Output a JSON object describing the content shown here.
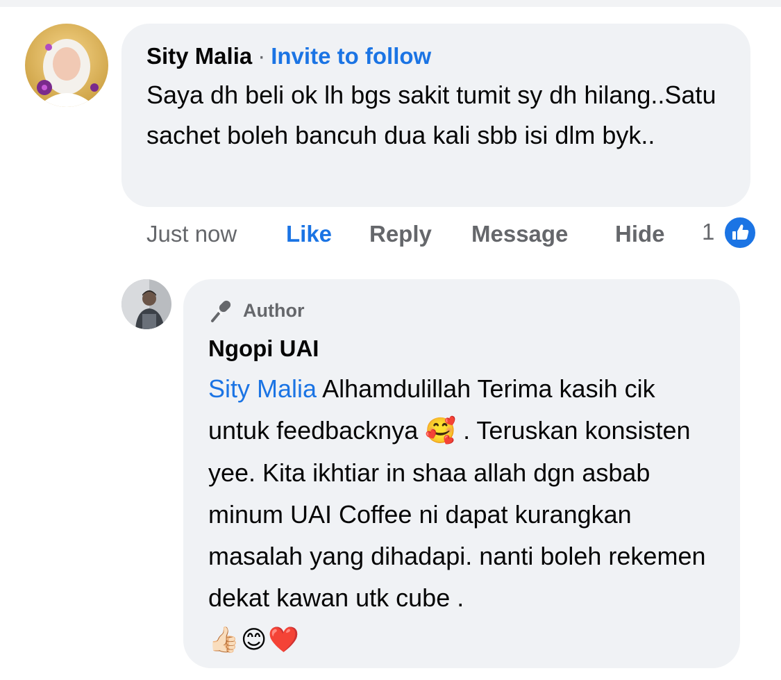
{
  "comment": {
    "author": "Sity Malia",
    "separator": "·",
    "invite_label": "Invite to follow",
    "text": "Saya dh beli ok lh bgs sakit tumit sy dh hilang..Satu sachet boleh bancuh dua kali sbb isi dlm byk..",
    "actions": {
      "time": "Just now",
      "like": "Like",
      "reply": "Reply",
      "message": "Message",
      "hide": "Hide"
    },
    "reaction_count": "1",
    "reaction_icon": "like-icon"
  },
  "reply": {
    "badge": "Author",
    "badge_icon": "microphone-icon",
    "author": "Ngopi UAI",
    "mention": "Sity Malia",
    "text_part1": " Alhamdulillah Terima kasih cik untuk feedbacknya ",
    "emoji_inline": "🥰",
    "text_part2": " . Teruskan konsisten yee. Kita ikhtiar in shaa allah dgn asbab minum UAI Coffee ni dapat kurangkan masalah yang dihadapi. nanti boleh rekemen dekat kawan utk cube .",
    "emoji_row": [
      "👍🏻",
      "😊",
      "❤️"
    ]
  },
  "colors": {
    "link": "#1b74e4",
    "bubble": "#f0f2f5",
    "muted": "#65676b",
    "text": "#050505"
  }
}
